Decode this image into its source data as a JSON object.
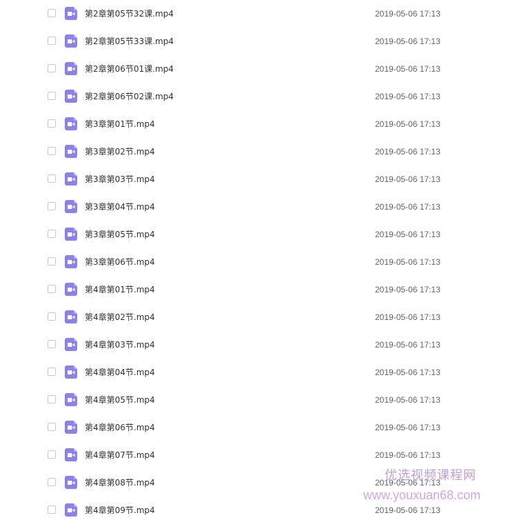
{
  "colors": {
    "video_icon": "#8b80f0",
    "watermark": "#b98ad1"
  },
  "file_icon_name": "video-file-icon",
  "files": [
    {
      "name": "第2章第05节32课.mp4",
      "modified": "2019-05-06 17:13"
    },
    {
      "name": "第2章第05节33课.mp4",
      "modified": "2019-05-06 17:13"
    },
    {
      "name": "第2章第06节01课.mp4",
      "modified": "2019-05-06 17:13"
    },
    {
      "name": "第2章第06节02课.mp4",
      "modified": "2019-05-06 17:13"
    },
    {
      "name": "第3章第01节.mp4",
      "modified": "2019-05-06 17:13"
    },
    {
      "name": "第3章第02节.mp4",
      "modified": "2019-05-06 17:13"
    },
    {
      "name": "第3章第03节.mp4",
      "modified": "2019-05-06 17:13"
    },
    {
      "name": "第3章第04节.mp4",
      "modified": "2019-05-06 17:13"
    },
    {
      "name": "第3章第05节.mp4",
      "modified": "2019-05-06 17:13"
    },
    {
      "name": "第3章第06节.mp4",
      "modified": "2019-05-06 17:13"
    },
    {
      "name": "第4章第01节.mp4",
      "modified": "2019-05-06 17:13"
    },
    {
      "name": "第4章第02节.mp4",
      "modified": "2019-05-06 17:13"
    },
    {
      "name": "第4章第03节.mp4",
      "modified": "2019-05-06 17:13"
    },
    {
      "name": "第4章第04节.mp4",
      "modified": "2019-05-06 17:13"
    },
    {
      "name": "第4章第05节.mp4",
      "modified": "2019-05-06 17:13"
    },
    {
      "name": "第4章第06节.mp4",
      "modified": "2019-05-06 17:13"
    },
    {
      "name": "第4章第07节.mp4",
      "modified": "2019-05-06 17:13"
    },
    {
      "name": "第4章第08节.mp4",
      "modified": "2019-05-06 17:13"
    },
    {
      "name": "第4章第09节.mp4",
      "modified": "2019-05-06 17:13"
    }
  ],
  "watermark": {
    "title": "优选视频课程网",
    "url": "www.youxuan68.com"
  }
}
